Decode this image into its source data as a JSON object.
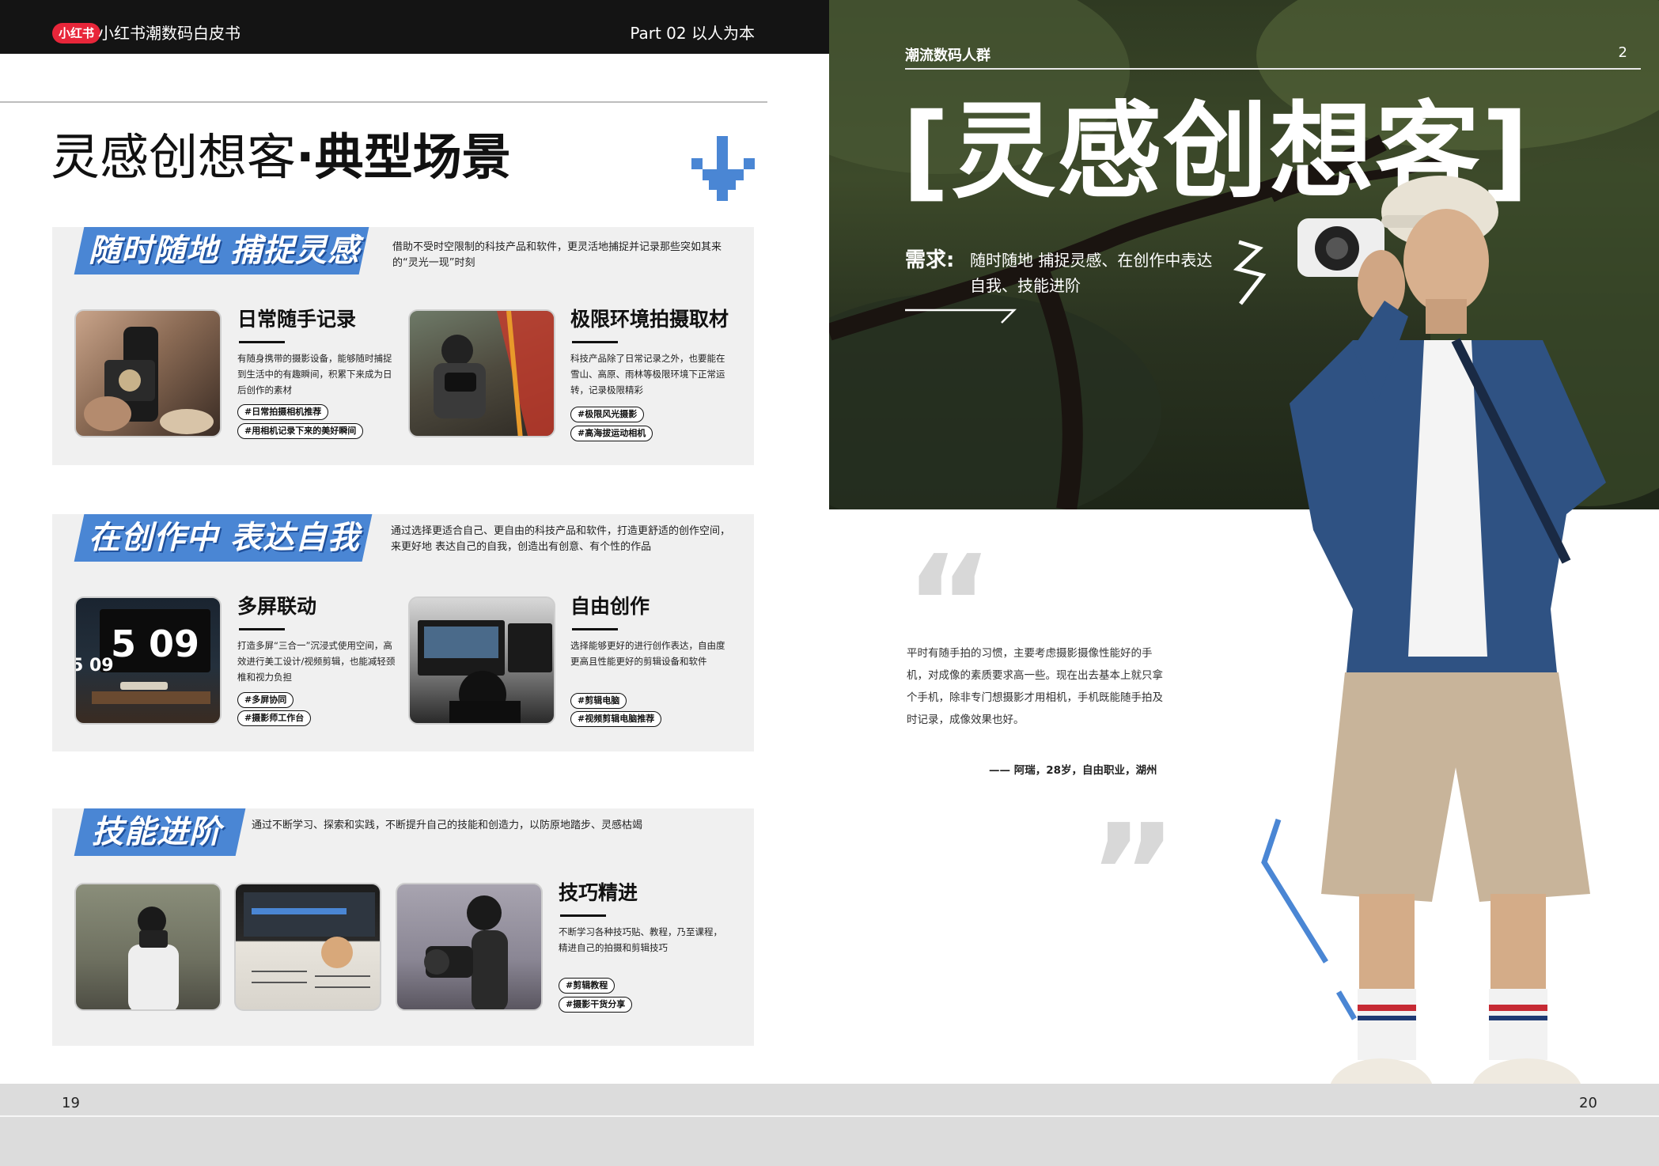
{
  "header": {
    "brand_badge": "小红书",
    "brand_title": "小红书潮数码白皮书",
    "part": "Part 02  以人为本"
  },
  "page_title": {
    "light": "灵感创想客",
    "dot": "·",
    "bold": "典型场景"
  },
  "sections": [
    {
      "banner": "随时随地 捕捉灵感",
      "desc": "借助不受时空限制的科技产品和软件，更灵活地捕捉并记录那些突如其来的“灵光一现”时刻",
      "cards": [
        {
          "title": "日常随手记录",
          "desc": "有随身携带的摄影设备，能够随时捕捉到生活中的有趣瞬间，积累下来成为日后创作的素材",
          "tags": [
            "#日常拍摄相机推荐",
            "#用相机记录下来的美好瞬间"
          ]
        },
        {
          "title": "极限环境拍摄取材",
          "desc": "科技产品除了日常记录之外，也要能在雪山、高原、雨林等极限环境下正常运转，记录极限精彩",
          "tags": [
            "#极限风光摄影",
            "#高海拔运动相机"
          ]
        }
      ]
    },
    {
      "banner": "在创作中 表达自我",
      "desc": "通过选择更适合自己、更自由的科技产品和软件，打造更舒适的创作空间，来更好地 表达自己的自我，创造出有创意、有个性的作品",
      "cards": [
        {
          "title": "多屏联动",
          "desc": "打造多屏“三合一”沉浸式使用空间，高效进行美工设计/视频剪辑，也能减轻颈椎和视力负担",
          "tags": [
            "#多屏协同",
            "#摄影师工作台"
          ],
          "clock": "5 09",
          "clock_small": "5 09"
        },
        {
          "title": "自由创作",
          "desc": "选择能够更好的进行创作表达，自由度更高且性能更好的剪辑设备和软件",
          "tags": [
            "#剪辑电脑",
            "#视频剪辑电脑推荐"
          ]
        }
      ]
    },
    {
      "banner": "技能进阶",
      "desc": "通过不断学习、探索和实践，不断提升自己的技能和创造力，以防原地踏步、灵感枯竭",
      "cards": [
        {
          "title": "技巧精进",
          "desc": "不断学习各种技巧贴、教程，乃至课程，精进自己的拍摄和剪辑技巧",
          "tags": [
            "#剪辑教程",
            "#摄影干货分享"
          ]
        }
      ]
    }
  ],
  "page_numbers": {
    "left": "19",
    "right": "20"
  },
  "right": {
    "header_label": "潮流数码人群",
    "header_num": "2",
    "big_title": "[灵感创想客]",
    "need_label": "需求:",
    "need_text": "随时随地 捕捉灵感、在创作中表达自我、技能进阶",
    "quote": "平时有随手拍的习惯，主要考虑摄影摄像性能好的手机，对成像的素质要求高一些。现在出去基本上就只拿个手机，除非专门想摄影才用相机，手机既能随手拍及时记录，成像效果也好。",
    "quote_author": "—— 阿瑞，28岁，自由职业，湖州",
    "quote_open": "“",
    "quote_close": "”"
  },
  "colors": {
    "accent_blue": "#4a86d4",
    "brand_red": "#e8263a",
    "top_bar": "#141414",
    "section_bg": "#f0f0f0"
  }
}
